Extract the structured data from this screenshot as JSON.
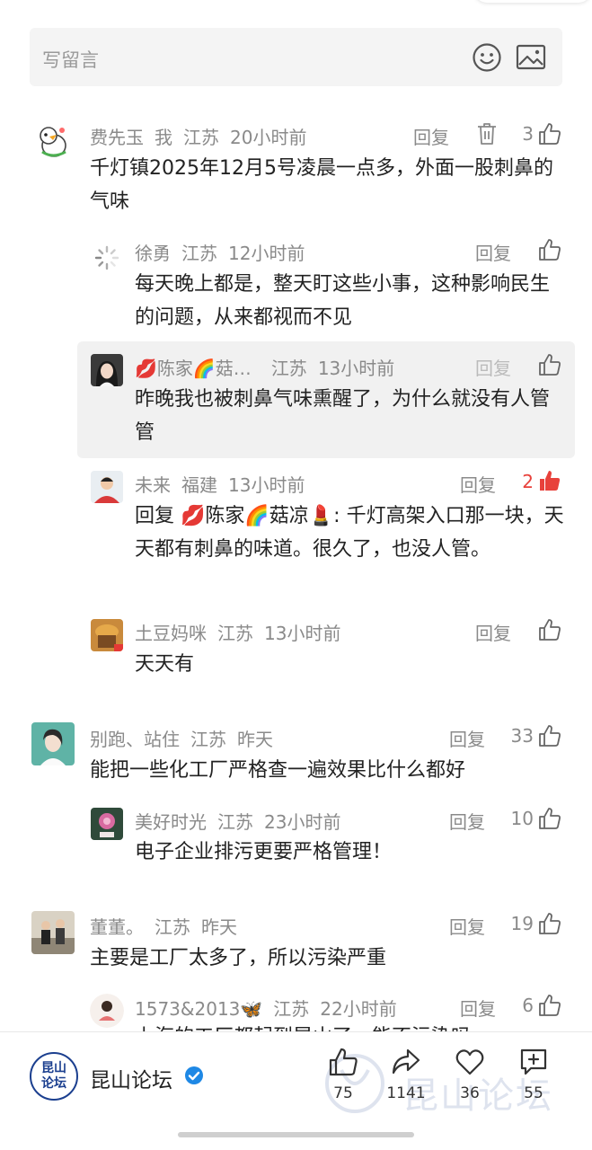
{
  "input": {
    "placeholder": "写留言"
  },
  "comments": [
    {
      "name": "费先玉",
      "tag": "我",
      "location": "江苏",
      "time": "20小时前",
      "reply": "回复",
      "likes": "3",
      "text": "千灯镇2025年12月5号凌晨一点多，外面一股刺鼻的气味"
    },
    {
      "name": "徐勇",
      "location": "江苏",
      "time": "12小时前",
      "reply": "回复",
      "likes": "",
      "text": "每天晚上都是，整天盯这些小事，这种影响民生的问题，从来都视而不见"
    },
    {
      "name": "💋陈家🌈菇…",
      "location": "江苏",
      "time": "13小时前",
      "reply": "回复",
      "likes": "",
      "text": "昨晚我也被刺鼻气味熏醒了，为什么就没有人管管"
    },
    {
      "name": "未来",
      "location": "福建",
      "time": "13小时前",
      "reply": "回复",
      "likes": "2",
      "text": "回复 💋陈家🌈菇凉💄: 千灯高架入口那一块，天天都有刺鼻的味道。很久了，也没人管。"
    },
    {
      "name": "土豆妈咪",
      "location": "江苏",
      "time": "13小时前",
      "reply": "回复",
      "likes": "",
      "text": "天天有"
    },
    {
      "name": "别跑、站住",
      "location": "江苏",
      "time": "昨天",
      "reply": "回复",
      "likes": "33",
      "text": "能把一些化工厂严格查一遍效果比什么都好"
    },
    {
      "name": "美好时光",
      "location": "江苏",
      "time": "23小时前",
      "reply": "回复",
      "likes": "10",
      "text": "电子企业排污更要严格管理！"
    },
    {
      "name": "董董。",
      "location": "江苏",
      "time": "昨天",
      "reply": "回复",
      "likes": "19",
      "text": "主要是工厂太多了，所以污染严重"
    },
    {
      "name": "1573&2013🦋",
      "location": "江苏",
      "time": "22小时前",
      "reply": "回复",
      "likes": "6",
      "text": "上海的工厂都起到昆山了，能不污染吗"
    }
  ],
  "bottom": {
    "logo_text": "昆山\n论坛",
    "forum_name": "昆山论坛",
    "watermark": "昆山论坛",
    "like_count": "75",
    "share_count": "1141",
    "fav_count": "36",
    "comment_count": "55"
  },
  "colors": {
    "like_active": "#e8413b",
    "meta_gray": "#8a8a8a",
    "brand_blue": "#1b3f8f",
    "verified_blue": "#1e88e5"
  }
}
